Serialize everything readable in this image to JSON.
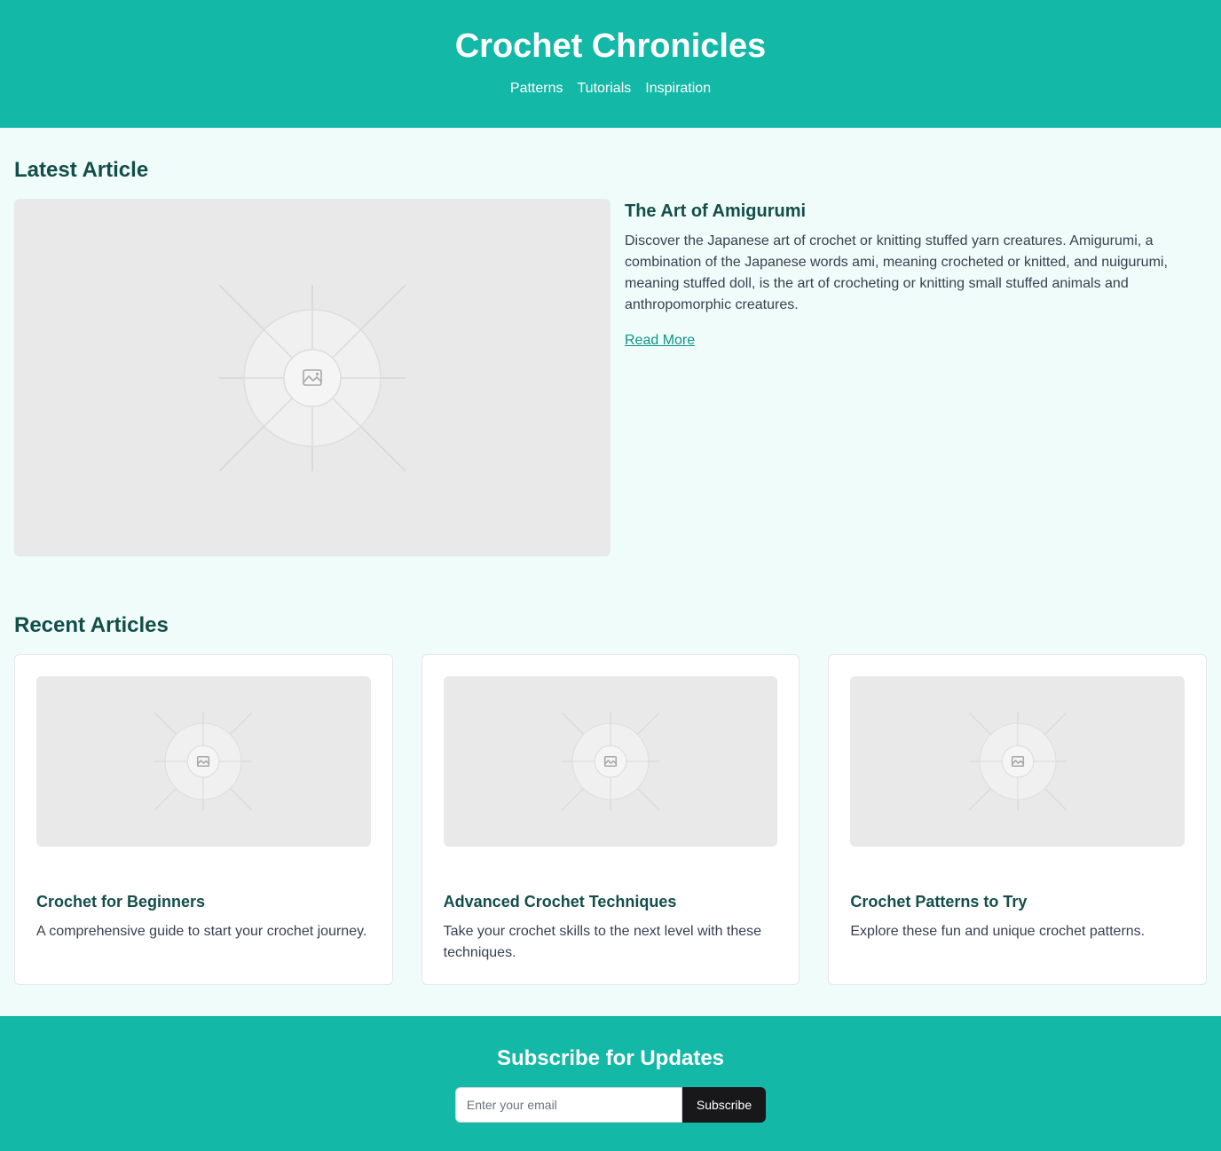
{
  "header": {
    "title": "Crochet Chronicles",
    "nav": [
      "Patterns",
      "Tutorials",
      "Inspiration"
    ]
  },
  "latest": {
    "heading": "Latest Article",
    "image_icon": "image-placeholder-icon",
    "title": "The Art of Amigurumi",
    "body": "Discover the Japanese art of crochet or knitting stuffed yarn creatures. Amigurumi, a combination of the Japanese words ami, meaning crocheted or knitted, and nuigurumi, meaning stuffed doll, is the art of crocheting or knitting small stuffed animals and anthropomorphic creatures.",
    "read_more": "Read More"
  },
  "recent": {
    "heading": "Recent Articles",
    "articles": [
      {
        "title": "Crochet for Beginners",
        "body": "A comprehensive guide to start your crochet journey."
      },
      {
        "title": "Advanced Crochet Techniques",
        "body": "Take your crochet skills to the next level with these techniques."
      },
      {
        "title": "Crochet Patterns to Try",
        "body": "Explore these fun and unique crochet patterns."
      }
    ]
  },
  "footer": {
    "heading": "Subscribe for Updates",
    "email_placeholder": "Enter your email",
    "subscribe_label": "Subscribe"
  },
  "colors": {
    "brand": "#14b8a6",
    "heading": "#134e4a",
    "link": "#0d9488",
    "page_bg": "#effcf9",
    "button_dark": "#18181b"
  }
}
